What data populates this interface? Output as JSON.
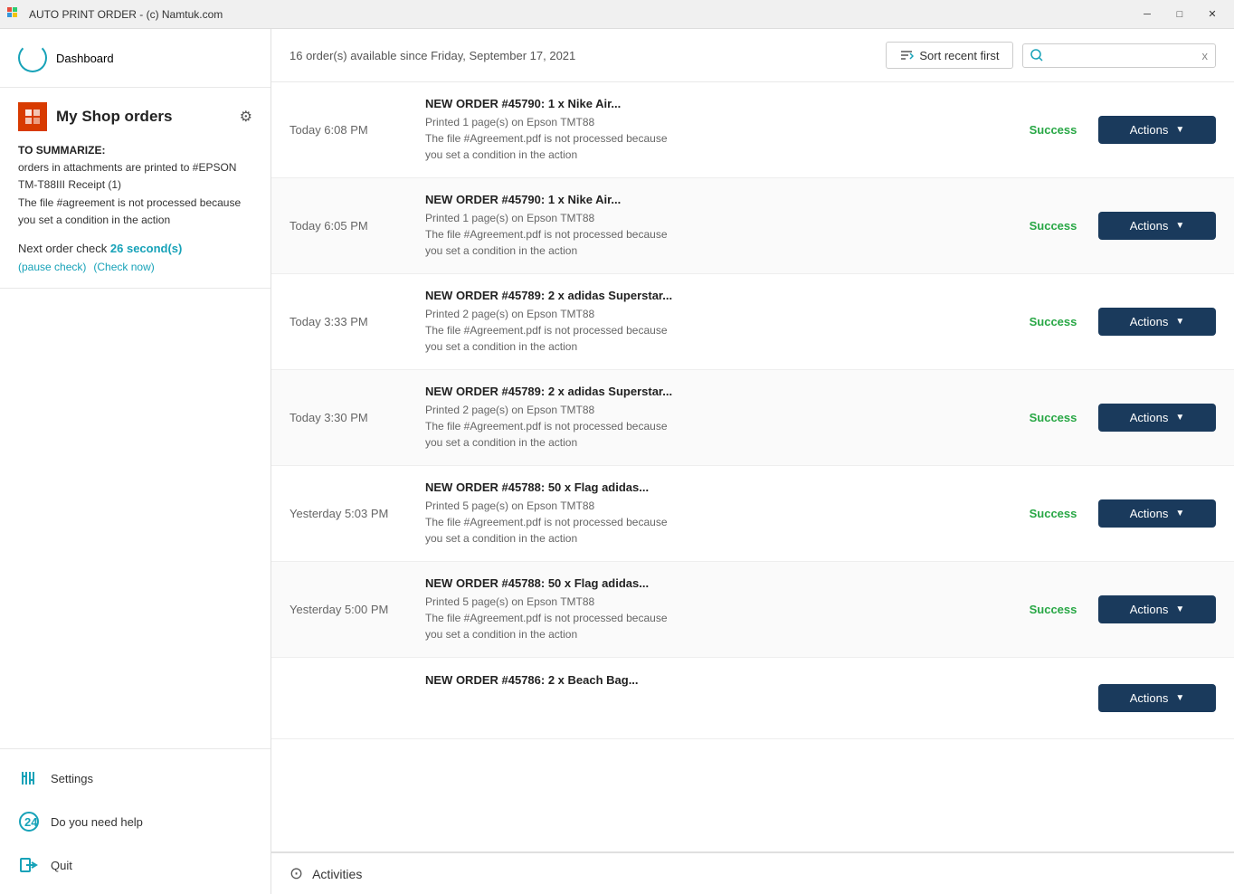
{
  "app": {
    "title": "AUTO PRINT ORDER - (c) Namtuk.com"
  },
  "titlebar": {
    "minimize_label": "─",
    "maximize_label": "□",
    "close_label": "✕"
  },
  "sidebar": {
    "dashboard_label": "Dashboard",
    "shop_name": "My Shop orders",
    "summarize_title": "TO SUMMARIZE:",
    "summarize_line1": "orders in attachments are printed to #EPSON TM-T88III Receipt (1)",
    "summarize_line2": "The file #agreement is not processed because you set a condition in the action",
    "next_check_prefix": "Next order check",
    "countdown": "26 second(s)",
    "pause_link": "(pause check)",
    "check_now_link": "(Check now)",
    "settings_label": "Settings",
    "help_label": "Do you need help",
    "quit_label": "Quit"
  },
  "toolbar": {
    "order_count_text": "16 order(s) available since Friday, September 17, 2021",
    "sort_label": "Sort recent first",
    "search_placeholder": "",
    "clear_label": "x"
  },
  "orders": [
    {
      "time": "Today 6:08 PM",
      "title": "NEW ORDER #45790: 1 x Nike Air...",
      "desc_line1": "Printed 1 page(s) on Epson TMT88",
      "desc_line2": "The file #Agreement.pdf is not processed because",
      "desc_line3": "you set a condition in the action",
      "status": "Success",
      "actions_label": "Actions"
    },
    {
      "time": "Today 6:05 PM",
      "title": "NEW ORDER #45790: 1 x Nike Air...",
      "desc_line1": "Printed 1 page(s) on Epson TMT88",
      "desc_line2": "The file #Agreement.pdf is not processed because",
      "desc_line3": "you set a condition in the action",
      "status": "Success",
      "actions_label": "Actions"
    },
    {
      "time": "Today 3:33 PM",
      "title": "NEW ORDER #45789: 2 x adidas Superstar...",
      "desc_line1": "Printed 2 page(s) on Epson TMT88",
      "desc_line2": "The file #Agreement.pdf is not processed because",
      "desc_line3": "you set a condition in the action",
      "status": "Success",
      "actions_label": "Actions"
    },
    {
      "time": "Today 3:30 PM",
      "title": "NEW ORDER #45789: 2 x adidas Superstar...",
      "desc_line1": "Printed 2 page(s) on Epson TMT88",
      "desc_line2": "The file #Agreement.pdf is not processed because",
      "desc_line3": "you set a condition in the action",
      "status": "Success",
      "actions_label": "Actions"
    },
    {
      "time": "Yesterday 5:03 PM",
      "title": "NEW ORDER #45788: 50 x Flag adidas...",
      "desc_line1": "Printed 5 page(s) on Epson TMT88",
      "desc_line2": "The file #Agreement.pdf is not processed because",
      "desc_line3": "you set a condition in the action",
      "status": "Success",
      "actions_label": "Actions"
    },
    {
      "time": "Yesterday 5:00 PM",
      "title": "NEW ORDER #45788: 50 x Flag adidas...",
      "desc_line1": "Printed 5 page(s) on Epson TMT88",
      "desc_line2": "The file #Agreement.pdf is not processed because",
      "desc_line3": "you set a condition in the action",
      "status": "Success",
      "actions_label": "Actions"
    },
    {
      "time": "",
      "title": "NEW ORDER #45786: 2 x Beach Bag...",
      "desc_line1": "",
      "desc_line2": "",
      "desc_line3": "",
      "status": "",
      "actions_label": "Actions"
    }
  ],
  "activities": {
    "label": "Activities",
    "icon": "⊙"
  }
}
